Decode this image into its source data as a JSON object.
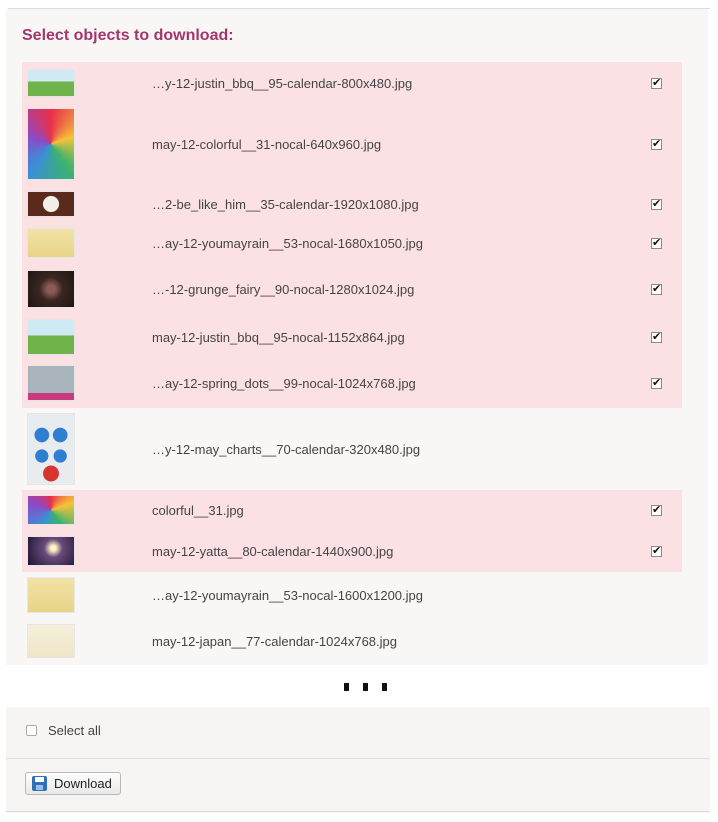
{
  "heading": "Select objects to download:",
  "items": [
    {
      "name": "…y-12-justin_bbq__95-calendar-800x480.jpg",
      "checked": true,
      "thumb": "landscape-cartoon"
    },
    {
      "name": "may-12-colorful__31-nocal-640x960.jpg",
      "checked": true,
      "thumb": "colorful-star"
    },
    {
      "name": "…2-be_like_him__35-calendar-1920x1080.jpg",
      "checked": true,
      "thumb": "dark-badge"
    },
    {
      "name": "…ay-12-youmayrain__53-nocal-1680x1050.jpg",
      "checked": true,
      "thumb": "yellow-rain"
    },
    {
      "name": "…-12-grunge_fairy__90-nocal-1280x1024.jpg",
      "checked": true,
      "thumb": "dark-fairy"
    },
    {
      "name": "may-12-justin_bbq__95-nocal-1152x864.jpg",
      "checked": true,
      "thumb": "landscape-cartoon"
    },
    {
      "name": "…ay-12-spring_dots__99-nocal-1024x768.jpg",
      "checked": true,
      "thumb": "grey-field"
    },
    {
      "name": "…y-12-may_charts__70-calendar-320x480.jpg",
      "checked": false,
      "thumb": "charts"
    },
    {
      "name": "colorful__31.jpg",
      "checked": true,
      "thumb": "colorful-star"
    },
    {
      "name": "may-12-yatta__80-calendar-1440x900.jpg",
      "checked": true,
      "thumb": "night-glow"
    },
    {
      "name": "…ay-12-youmayrain__53-nocal-1600x1200.jpg",
      "checked": false,
      "thumb": "yellow-rain"
    },
    {
      "name": "may-12-japan__77-calendar-1024x768.jpg",
      "checked": false,
      "thumb": "light-japan"
    }
  ],
  "check_glyph": "✔",
  "select_all_label": "Select all",
  "download_label": "Download"
}
